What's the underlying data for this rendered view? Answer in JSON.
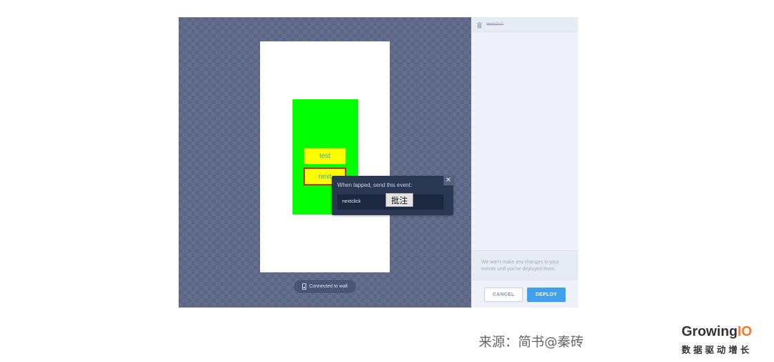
{
  "canvas": {
    "buttons": [
      {
        "label": "test"
      },
      {
        "label": "next"
      }
    ],
    "status": {
      "label": "Connected to wall"
    }
  },
  "popup": {
    "title": "When tapped, send this event:",
    "close_symbol": "✕",
    "event_value": "nextclick",
    "annotation": "批注"
  },
  "sidebar": {
    "header_label": "testclick",
    "note": "We won't make any changes to your events until you've deployed them.",
    "cancel_label": "CANCEL",
    "deploy_label": "DEPLOY"
  },
  "footer": {
    "source": "来源：简书@秦砖",
    "brand_main": "Growing",
    "brand_accent": "IO",
    "brand_tagline": "数据驱动增长"
  },
  "icons": {
    "trash": "trash-icon",
    "phone": "phone-icon",
    "close": "close-icon"
  },
  "colors": {
    "canvas_bg": "#5c6686",
    "green_view": "#00ff00",
    "yellow_button": "#ffff00",
    "selected_border": "#d2231e",
    "popup_bg": "#2a3752",
    "deploy_bg": "#42a1ee",
    "brand_accent": "#f5782a"
  }
}
